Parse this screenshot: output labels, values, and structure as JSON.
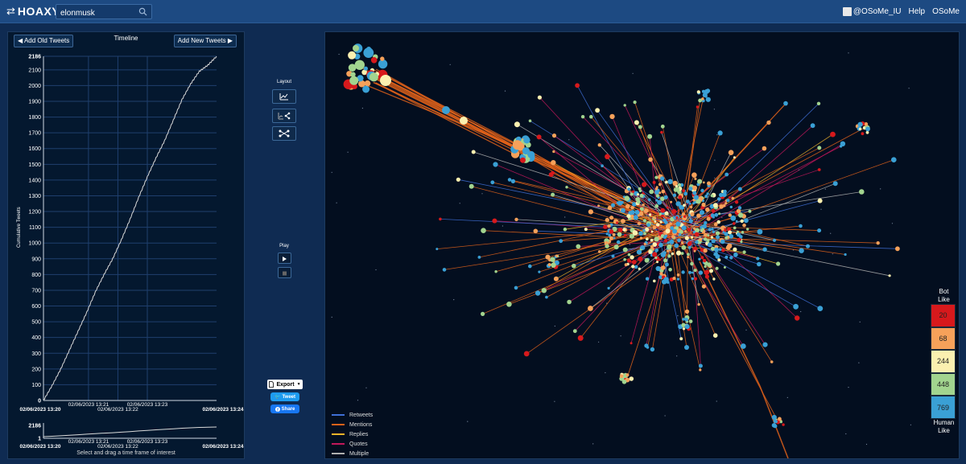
{
  "app": {
    "logo_text": "HOAXY",
    "logo_dot": "®"
  },
  "search": {
    "value": "elonmusk"
  },
  "header": {
    "user": "@OSoMe_IU",
    "help": "Help",
    "osome": "OSoMe"
  },
  "timeline": {
    "title": "Timeline",
    "add_old": "Add Old Tweets",
    "add_new": "Add New Tweets",
    "ylabel": "Cumulative Tweets",
    "brush_caption": "Select and drag a time frame of interest"
  },
  "chart_data": {
    "type": "line",
    "ylabel": "Cumulative Tweets",
    "ylim": [
      0,
      2186
    ],
    "yticks": [
      0,
      100,
      200,
      300,
      400,
      500,
      600,
      700,
      800,
      900,
      1000,
      1100,
      1200,
      1300,
      1400,
      1500,
      1600,
      1700,
      1800,
      1900,
      2000,
      2100,
      2186
    ],
    "xticks": [
      {
        "label": "02/06/2023 13:20",
        "t": 0,
        "bold": true
      },
      {
        "label": "02/06/2023 13:21",
        "t": 0.26
      },
      {
        "label": "02/06/2023 13:22",
        "t": 0.43
      },
      {
        "label": "02/06/2023 13:23",
        "t": 0.6
      },
      {
        "label": "02/06/2023 13:24",
        "t": 1,
        "bold": true
      }
    ],
    "x": [
      0,
      0.05,
      0.1,
      0.15,
      0.2,
      0.25,
      0.3,
      0.35,
      0.4,
      0.45,
      0.5,
      0.55,
      0.6,
      0.65,
      0.7,
      0.75,
      0.8,
      0.85,
      0.9,
      0.95,
      1.0
    ],
    "y": [
      0,
      95,
      200,
      320,
      440,
      560,
      690,
      800,
      900,
      1020,
      1150,
      1290,
      1420,
      1540,
      1650,
      1780,
      1910,
      2010,
      2090,
      2130,
      2186
    ],
    "grid": true,
    "brush": {
      "ylim": [
        1,
        2186
      ],
      "yticks": [
        1,
        2186
      ]
    }
  },
  "controls": {
    "layout_label": "Layout",
    "play_label": "Play",
    "export_label": "Export",
    "tweet_label": "Tweet",
    "share_label": "Share"
  },
  "legend": [
    {
      "label": "Retweets",
      "color": "#3f6fd6"
    },
    {
      "label": "Mentions",
      "color": "#e0621a"
    },
    {
      "label": "Replies",
      "color": "#f0b429"
    },
    {
      "label": "Quotes",
      "color": "#c2185b"
    },
    {
      "label": "Multiple",
      "color": "#b0b0b0"
    }
  ],
  "botscale": {
    "top": [
      "Bot",
      "Like"
    ],
    "bottom": [
      "Human",
      "Like"
    ],
    "levels": [
      {
        "value": "20",
        "color": "#d7191c"
      },
      {
        "value": "68",
        "color": "#f6a15a"
      },
      {
        "value": "244",
        "color": "#fbf0b0"
      },
      {
        "value": "448",
        "color": "#a2d48f"
      },
      {
        "value": "769",
        "color": "#3aa0d5"
      }
    ]
  }
}
